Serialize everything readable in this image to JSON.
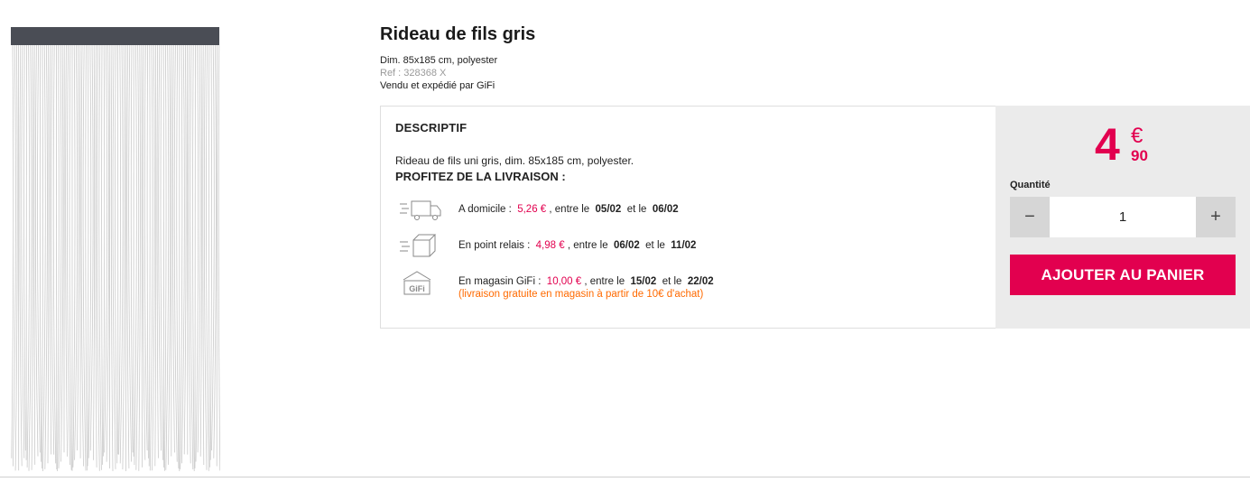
{
  "product": {
    "title": "Rideau de fils gris",
    "dimensions": "Dim. 85x185 cm, polyester",
    "reference": "Ref : 328368 X",
    "seller": "Vendu et expédié par GiFi",
    "image_icon": "string-curtain-image"
  },
  "description": {
    "heading": "DESCRIPTIF",
    "text": "Rideau de fils uni gris, dim. 85x185 cm, polyester.",
    "promo_heading": "PROFITEZ DE LA LIVRAISON :"
  },
  "shipping": [
    {
      "icon": "delivery-truck-icon",
      "label": "A domicile :",
      "price": "5,26 €",
      "between": ", entre le",
      "from": "05/02",
      "and": "et le",
      "to": "06/02",
      "note": ""
    },
    {
      "icon": "package-box-icon",
      "label": "En point relais :",
      "price": "4,98 €",
      "between": ", entre le",
      "from": "06/02",
      "and": "et le",
      "to": "11/02",
      "note": ""
    },
    {
      "icon": "gifi-store-icon",
      "label": "En magasin GiFi :",
      "price": "10,00 €",
      "between": ", entre le",
      "from": "15/02",
      "and": "et le",
      "to": "22/02",
      "note": "(livraison gratuite en magasin à partir de 10€ d'achat)"
    }
  ],
  "price": {
    "euros": "4",
    "currency": "€",
    "cents": "90"
  },
  "purchase": {
    "quantity_label": "Quantité",
    "quantity_value": "1",
    "minus_label": "−",
    "plus_label": "+",
    "add_to_cart_label": "AJOUTER AU PANIER"
  },
  "colors": {
    "accent": "#e2004f",
    "note": "#ff6a00",
    "panel_bg": "#ebebeb"
  }
}
